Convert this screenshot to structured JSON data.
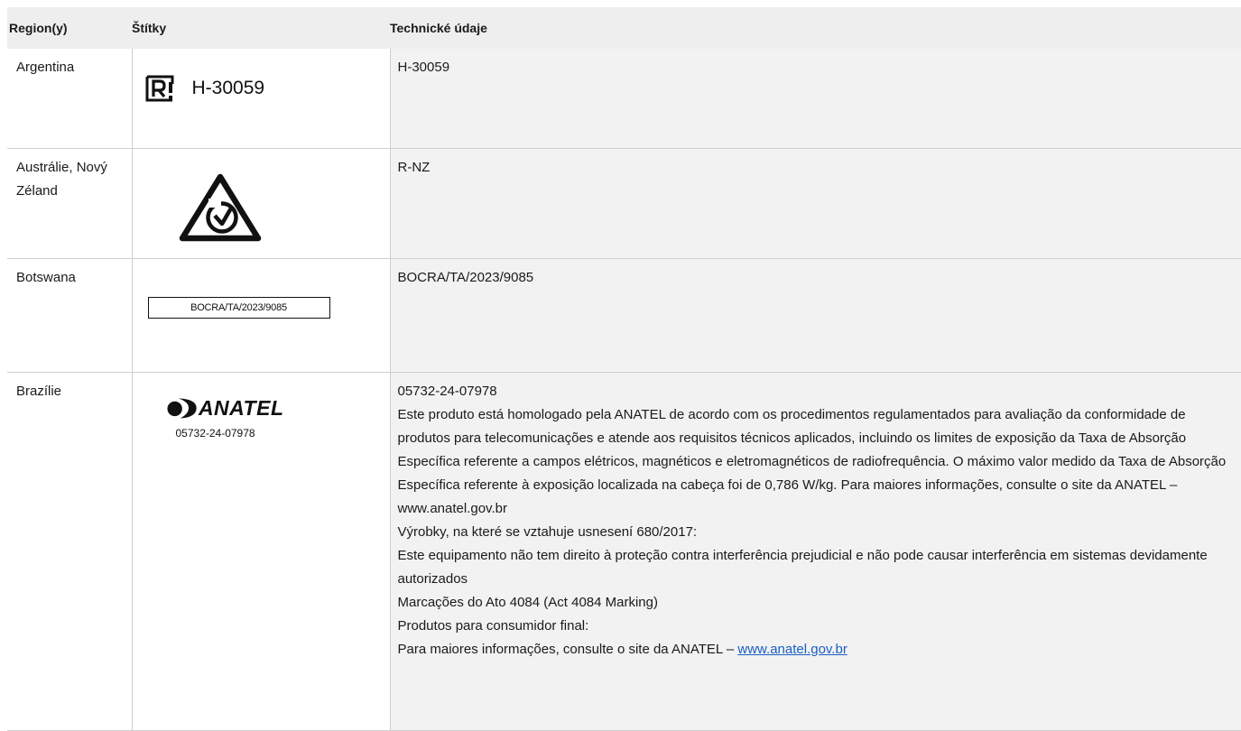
{
  "headers": {
    "region": "Region(y)",
    "labels": "Štítky",
    "specs": "Technické údaje"
  },
  "rows": [
    {
      "region": "Argentina",
      "label_text": "H-30059",
      "label_icon": "registered-r-icon",
      "specs": [
        "H-30059"
      ]
    },
    {
      "region": "Austrálie, Nový Zéland",
      "label_icon": "rcm-triangle-check-icon",
      "specs": [
        "R-NZ"
      ]
    },
    {
      "region": "Botswana",
      "label_text": "BOCRA/TA/2023/9085",
      "specs": [
        "BOCRA/TA/2023/9085"
      ]
    },
    {
      "region": "Brazílie",
      "label_icon": "anatel-logo-icon",
      "label_brand": "ANATEL",
      "label_text": "05732-24-07978",
      "specs": [
        "05732-24-07978",
        "Este produto está homologado pela ANATEL de acordo com os procedimentos regulamentados para avaliação da conformidade de produtos para telecomunicações e atende aos requisitos técnicos aplicados, incluindo os limites de exposição da Taxa de Absorção Específica referente a campos elétricos, magnéticos e eletromagnéticos de radiofrequência. O máximo valor medido da Taxa de Absorção Específica referente à exposição localizada na cabeça foi de 0,786 W/kg. Para maiores informações, consulte o site da ANATEL – www.anatel.gov.br",
        "Výrobky, na které se vztahuje usnesení 680/2017:",
        "Este equipamento não tem direito à proteção contra interferência prejudicial e não pode causar interferência em sistemas devidamente autorizados",
        "Marcações do Ato 4084 (Act 4084 Marking)",
        "Produtos para consumidor final:"
      ],
      "last_line_prefix": "Para maiores informações, consulte o site da ANATEL – ",
      "last_line_link": "www.anatel.gov.br"
    }
  ],
  "colors": {
    "header_bg": "#eeeeee",
    "spec_bg": "#f2f2f2",
    "link": "#1b5fc1",
    "border": "#cfcfcf"
  }
}
